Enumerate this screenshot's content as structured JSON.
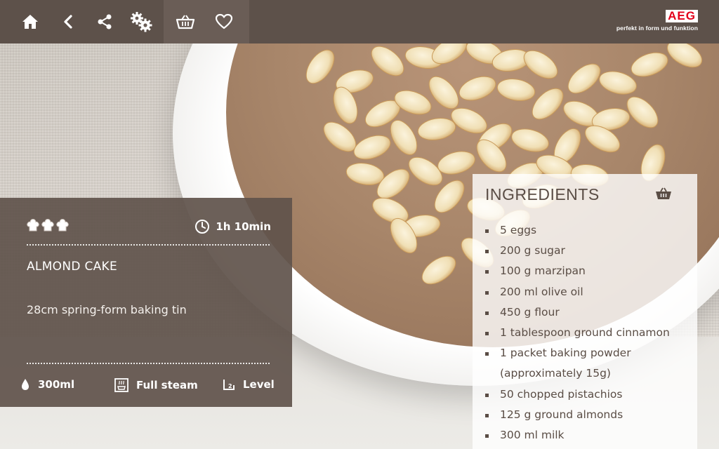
{
  "brand": {
    "logo": "AEG",
    "tagline": "perfekt in form und funktion"
  },
  "toolbar": {
    "buttons": [
      {
        "name": "home-button",
        "icon": "home-icon"
      },
      {
        "name": "back-button",
        "icon": "chevron-left-icon"
      },
      {
        "name": "share-button",
        "icon": "share-icon"
      },
      {
        "name": "settings-button",
        "icon": "gears-icon"
      },
      {
        "name": "basket-button",
        "icon": "basket-icon"
      },
      {
        "name": "favorite-button",
        "icon": "heart-icon"
      }
    ]
  },
  "recipe": {
    "difficulty_level": 3,
    "difficulty_max": 3,
    "time": "1h 10min",
    "title": "ALMOND CAKE",
    "description": "28cm spring-form baking tin",
    "water": "300ml",
    "mode": "Full steam",
    "level": "Level"
  },
  "ingredients": {
    "title": "INGREDIENTS",
    "items": [
      "5 eggs",
      "200 g sugar",
      "100 g marzipan",
      "200 ml olive oil",
      "450 g flour",
      "1 tablespoon ground cinnamon",
      "1 packet baking powder (approximately 15g)",
      "50 chopped pistachios",
      "125 g ground almonds",
      "300 ml milk"
    ]
  },
  "colors": {
    "topbar": "#5d514a",
    "panel": "#5f534b",
    "brand_red": "#e3001b"
  }
}
